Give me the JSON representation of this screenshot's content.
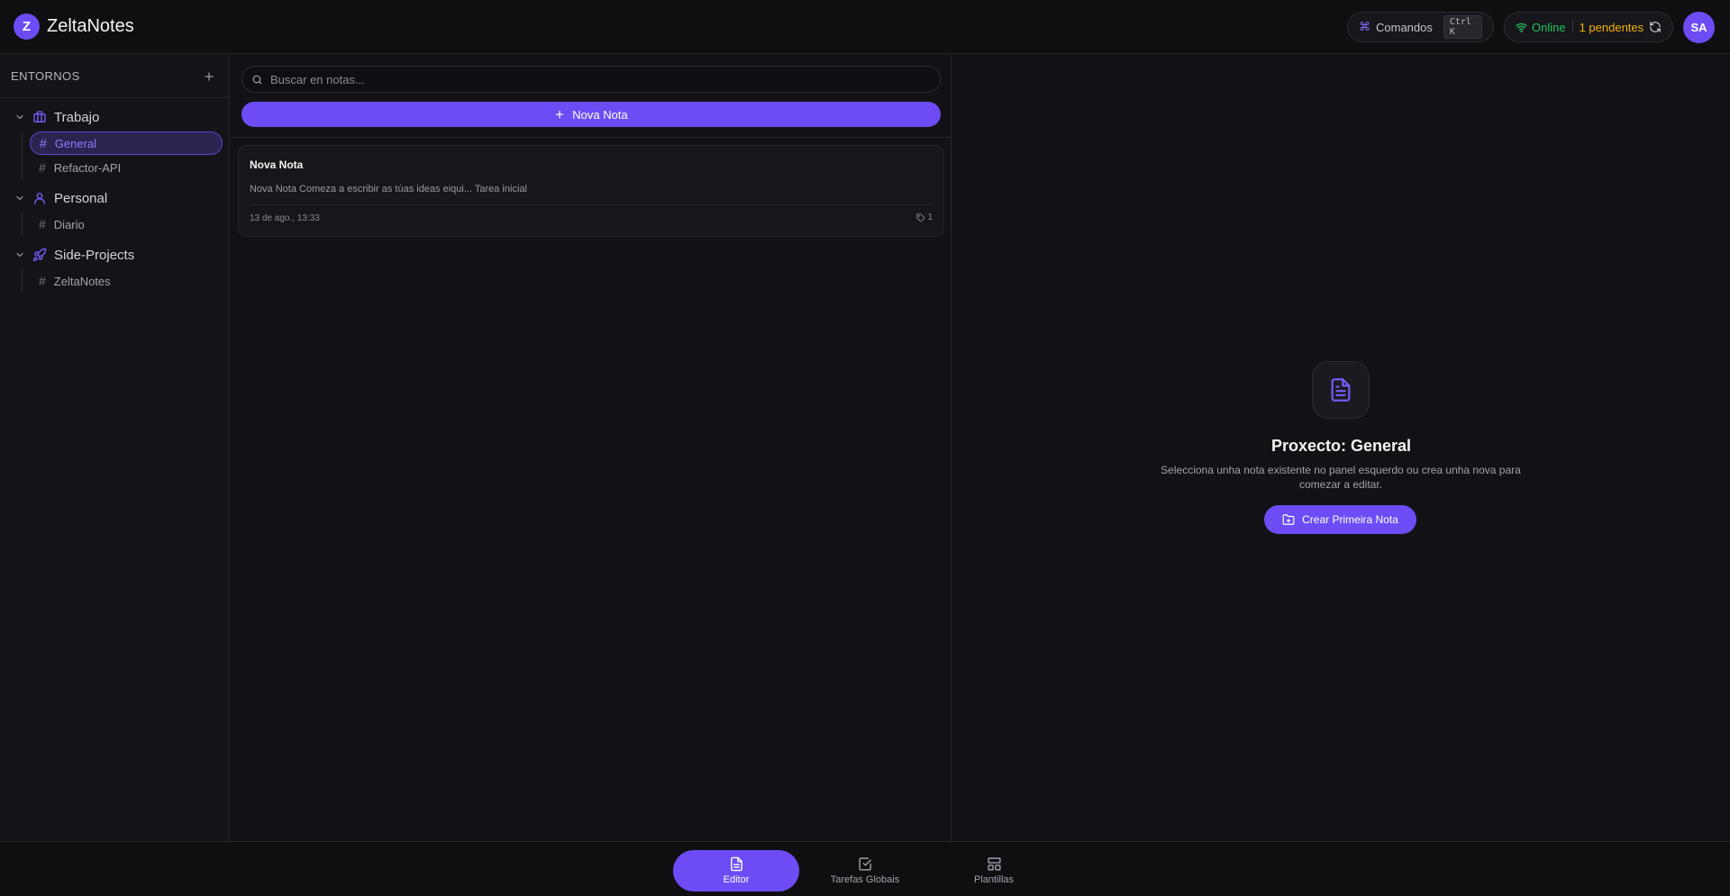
{
  "app": {
    "logo_letter": "Z",
    "title": "ZeltaNotes"
  },
  "header": {
    "commands_label": "Comandos",
    "commands_shortcut": "Ctrl K",
    "status_online": "Online",
    "status_pending": "1 pendentes",
    "avatar_initials": "SA"
  },
  "sidebar": {
    "heading": "ENTORNOS",
    "environments": [
      {
        "name": "Trabajo",
        "icon": "briefcase-icon",
        "projects": [
          {
            "name": "General",
            "active": true
          },
          {
            "name": "Refactor-API",
            "active": false
          }
        ]
      },
      {
        "name": "Personal",
        "icon": "user-icon",
        "projects": [
          {
            "name": "Diario",
            "active": false
          }
        ]
      },
      {
        "name": "Side-Projects",
        "icon": "rocket-icon",
        "projects": [
          {
            "name": "ZeltaNotes",
            "active": false
          }
        ]
      }
    ]
  },
  "notes": {
    "search_placeholder": "Buscar en notas...",
    "new_note_label": "Nova Nota",
    "items": [
      {
        "title": "Nova Nota",
        "preview": "Nova Nota Comeza a escribir as túas ideas eiqui... Tarea inicial",
        "date": "13 de ago., 13:33",
        "tag_count": "1"
      }
    ]
  },
  "editor": {
    "empty_title": "Proxecto: General",
    "empty_desc": "Selecciona unha nota existente no panel esquerdo ou crea unha nova para comezar a editar.",
    "create_button": "Crear Primeira Nota"
  },
  "bottom_nav": {
    "editor": "Editor",
    "tasks": "Tarefas Globais",
    "templates": "Plantillas"
  },
  "colors": {
    "accent": "#6d4cf5",
    "online": "#22c55e",
    "pending": "#f5b300",
    "background": "#121216"
  }
}
